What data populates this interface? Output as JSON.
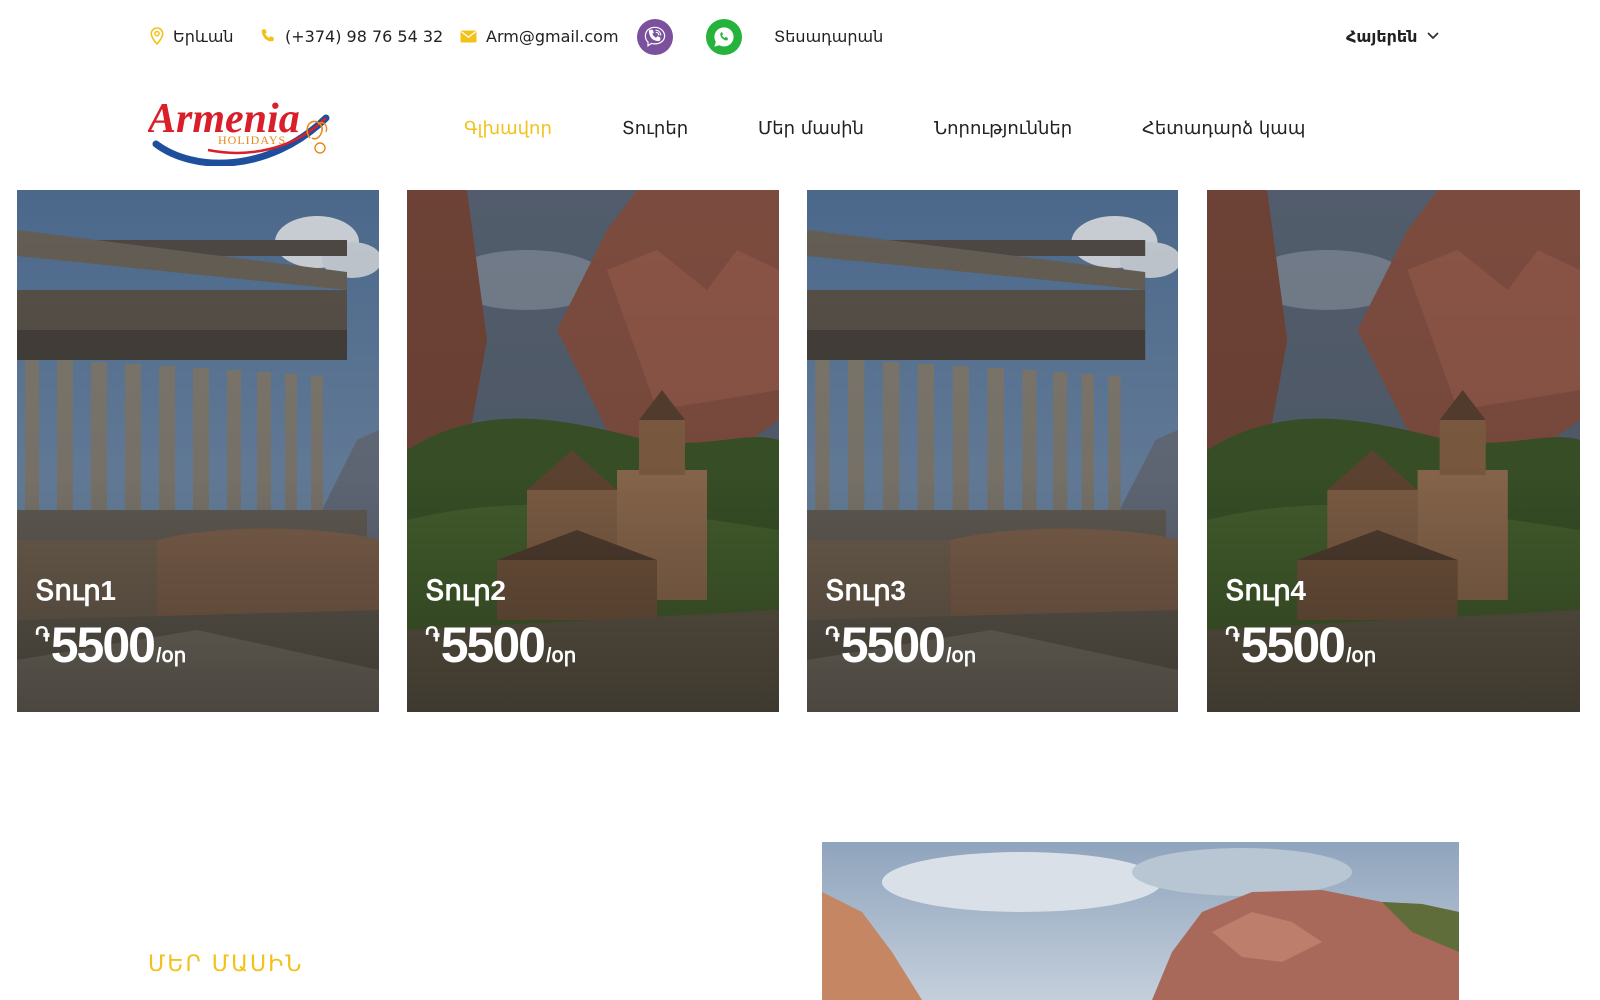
{
  "topbar": {
    "location": "Երևան",
    "phone": "(+374) 98 76 54 32",
    "email": "Arm@gmail.com",
    "map_link": "Տեսադարան",
    "language": "Հայերեն"
  },
  "logo": {
    "main": "Armenia",
    "sub": "HOLIDAYS"
  },
  "nav": {
    "items": [
      "Գլխավոր",
      "Տուրեր",
      "Մեր մասին",
      "Նորություններ",
      "Հետադարձ կապ"
    ]
  },
  "tours": [
    {
      "title": "Տուր1",
      "currency": "֏",
      "price": "5500",
      "unit": "/օր"
    },
    {
      "title": "Տուր2",
      "currency": "֏",
      "price": "5500",
      "unit": "/օր"
    },
    {
      "title": "Տուր3",
      "currency": "֏",
      "price": "5500",
      "unit": "/օր"
    },
    {
      "title": "Տուր4",
      "currency": "֏",
      "price": "5500",
      "unit": "/օր"
    }
  ],
  "about": {
    "title": "ՄԵՐ ՄԱՍԻՆ"
  },
  "colors": {
    "accent": "#f2c21b",
    "viber": "#7b519d",
    "whatsapp": "#25b33b",
    "logo_red": "#d81f2a",
    "logo_blue": "#1d4f9c"
  }
}
